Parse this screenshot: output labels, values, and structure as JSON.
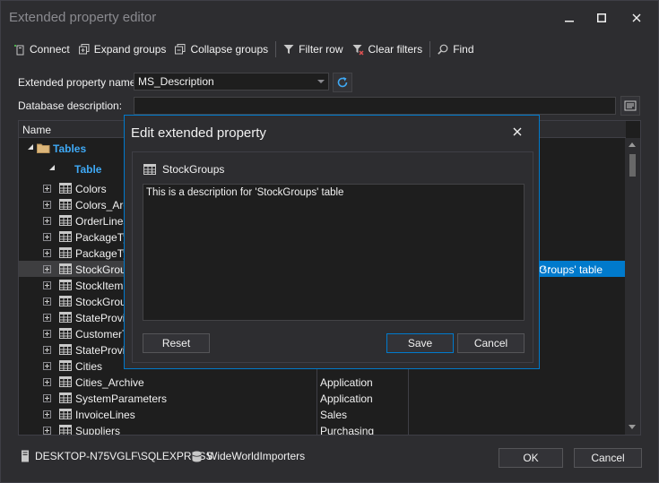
{
  "window": {
    "title": "Extended property editor",
    "minimize": "—",
    "maximize": "□",
    "close": "✕"
  },
  "toolbar": {
    "connect": "Connect",
    "expand_groups": "Expand groups",
    "collapse_groups": "Collapse groups",
    "filter_row": "Filter row",
    "clear_filters": "Clear filters",
    "find": "Find"
  },
  "form": {
    "property_name_label": "Extended property name:",
    "property_name_value": "MS_Description",
    "db_description_label": "Database description:",
    "db_description_value": ""
  },
  "grid": {
    "header_name": "Name",
    "group_tables": "Tables",
    "group_table": "Table",
    "rows": [
      {
        "name": "Colors",
        "schema": ""
      },
      {
        "name": "Colors_Archive",
        "schema": ""
      },
      {
        "name": "OrderLines",
        "schema": ""
      },
      {
        "name": "PackageTypes",
        "schema": ""
      },
      {
        "name": "PackageTypes_Archive",
        "schema": ""
      },
      {
        "name": "StockGroups",
        "schema": ""
      },
      {
        "name": "StockItemStockGroups",
        "schema": ""
      },
      {
        "name": "StockGroups_Archive",
        "schema": ""
      },
      {
        "name": "StateProvinces",
        "schema": ""
      },
      {
        "name": "CustomerTransactions",
        "schema": ""
      },
      {
        "name": "StateProvinces_Archive",
        "schema": ""
      },
      {
        "name": "Cities",
        "schema": ""
      },
      {
        "name": "Cities_Archive",
        "schema": "Application"
      },
      {
        "name": "SystemParameters",
        "schema": "Application"
      },
      {
        "name": "InvoiceLines",
        "schema": "Sales"
      },
      {
        "name": "Suppliers",
        "schema": "Purchasing"
      }
    ],
    "selected_cell_text": "Groups' table",
    "ellipsis": "···"
  },
  "status": {
    "server": "DESKTOP-N75VGLF\\SQLEXPRESS",
    "database": "WideWorldImporters"
  },
  "buttons": {
    "ok": "OK",
    "cancel": "Cancel"
  },
  "dialog": {
    "title": "Edit extended property",
    "close": "✕",
    "object_name": "StockGroups",
    "description_text": "This is a description for 'StockGroups' table",
    "reset": "Reset",
    "save": "Save",
    "cancel": "Cancel"
  },
  "colors": {
    "accent": "#007acc",
    "group_text": "#3fa9f5",
    "background": "#2d2d30",
    "field": "#1e1e1e"
  }
}
